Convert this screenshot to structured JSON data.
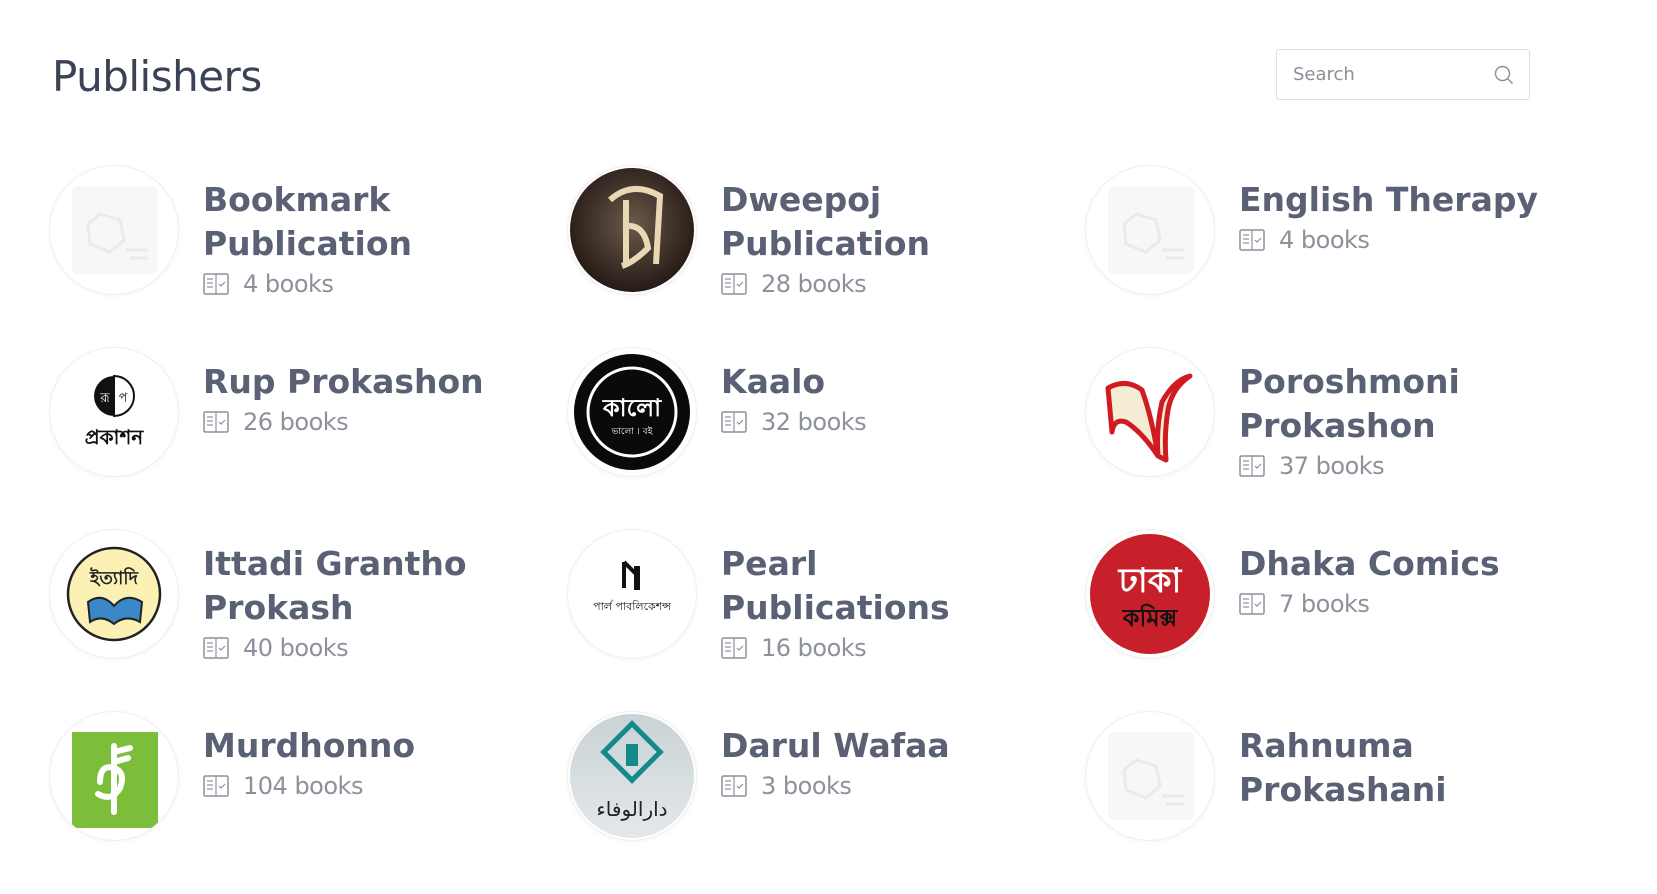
{
  "page": {
    "title": "Publishers"
  },
  "search": {
    "placeholder": "Search"
  },
  "publishers": [
    {
      "name": "Bookmark Publication",
      "count": "4 books",
      "logo": "placeholder-pen-icon"
    },
    {
      "name": "Dweepoj Publication",
      "count": "28 books",
      "logo": "dweepoj-logo"
    },
    {
      "name": "English Therapy",
      "count": "4 books",
      "logo": "placeholder-pen-icon"
    },
    {
      "name": "Rup Prokashon",
      "count": "26 books",
      "logo": "rup-prokashon-logo",
      "logo_text": {
        "top_left": "রূ",
        "top_right": "প",
        "bottom": "প্রকাশন"
      }
    },
    {
      "name": "Kaalo",
      "count": "32 books",
      "logo": "kaalo-logo",
      "logo_text": {
        "main": "কালো",
        "sub": "ভালো । বই"
      }
    },
    {
      "name": "Poroshmoni Prokashon",
      "count": "37 books",
      "logo": "poroshmoni-logo"
    },
    {
      "name": "Ittadi Grantho Prokash",
      "count": "40 books",
      "logo": "ittadi-logo",
      "logo_text": {
        "main": "ইত্যাদি"
      }
    },
    {
      "name": "Pearl Publications",
      "count": "16 books",
      "logo": "pearl-logo",
      "logo_text": {
        "main": "পার্ল পাবলিকেশন্স"
      }
    },
    {
      "name": "Dhaka Comics",
      "count": "7 books",
      "logo": "dhaka-comics-logo",
      "logo_text": {
        "top": "ঢাকা",
        "bottom": "কমিক্স"
      }
    },
    {
      "name": "Murdhonno",
      "count": "104 books",
      "logo": "murdhonno-logo"
    },
    {
      "name": "Darul Wafaa",
      "count": "3 books",
      "logo": "darul-wafaa-logo",
      "logo_text": {
        "main": "دارالوفاء"
      }
    },
    {
      "name": "Rahnuma Prokashani",
      "count": "",
      "logo": "placeholder-pen-icon"
    }
  ],
  "colors": {
    "title": "#3a4256",
    "name": "#5a6175",
    "count": "#8d919c",
    "border": "#dcdfe4"
  }
}
